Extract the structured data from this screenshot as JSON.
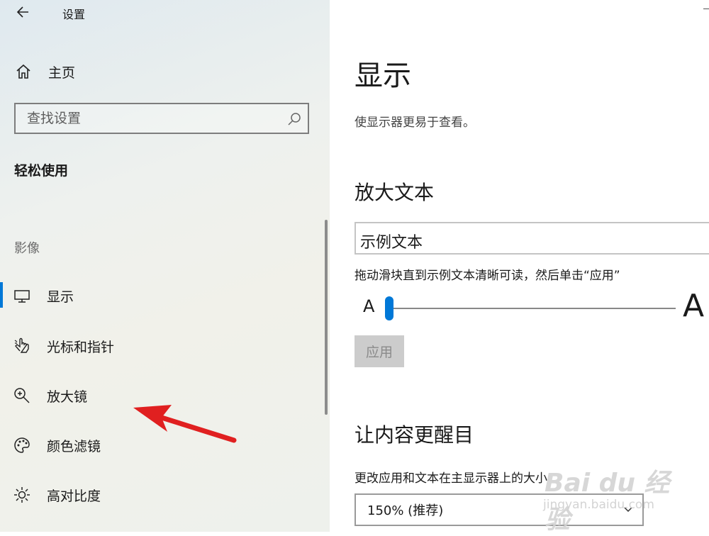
{
  "window": {
    "title": "设置"
  },
  "sidebar": {
    "home_label": "主页",
    "search": {
      "placeholder": "查找设置",
      "value": ""
    },
    "section_title": "轻松使用",
    "group_label": "影像",
    "items": [
      {
        "label": "显示",
        "icon": "monitor-icon",
        "active": true
      },
      {
        "label": "光标和指针",
        "icon": "pointer-hand-icon"
      },
      {
        "label": "放大镜",
        "icon": "magnifier-zoom-icon"
      },
      {
        "label": "颜色滤镜",
        "icon": "color-palette-icon"
      },
      {
        "label": "高对比度",
        "icon": "brightness-sun-icon"
      }
    ]
  },
  "main": {
    "title": "显示",
    "description": "使显示器更易于查看。",
    "enlarge_text": {
      "heading": "放大文本",
      "sample_text": "示例文本",
      "instruction": "拖动滑块直到示例文本清晰可读，然后单击“应用”",
      "small_a": "A",
      "large_a": "A",
      "slider_value_percent": 100,
      "apply_label": "应用"
    },
    "make_prominent": {
      "heading": "让内容更醒目",
      "size_label": "更改应用和文本在主显示器上的大小",
      "size_value": "150% (推荐)"
    }
  },
  "watermark": {
    "line1": "Bai du 经验",
    "line2": "jingyan.baidu.com"
  },
  "colors": {
    "accent": "#0078d7",
    "arrow": "#e02020"
  }
}
